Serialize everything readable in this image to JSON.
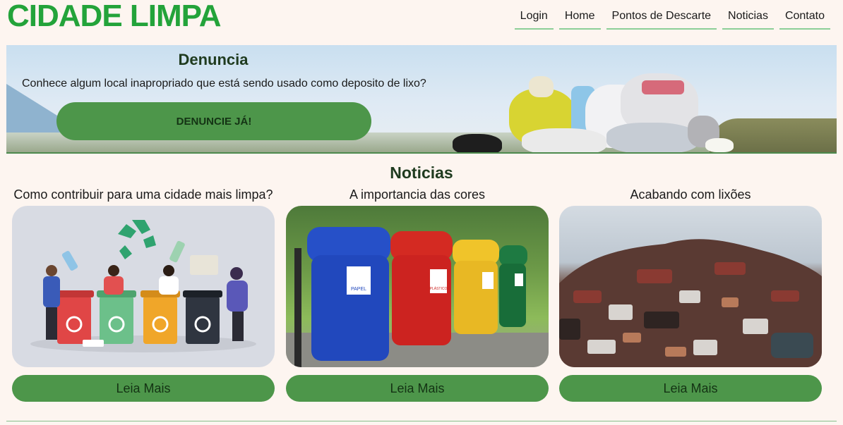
{
  "header": {
    "logo": "CIDADE LIMPA",
    "nav": [
      "Login",
      "Home",
      "Pontos de Descarte",
      "Noticias",
      "Contato"
    ]
  },
  "banner": {
    "title": "Denuncia",
    "text": "Conhece algum local inapropriado que está sendo usado como deposito de lixo?",
    "button": "DENUNCIE JÁ!"
  },
  "news": {
    "title": "Noticias",
    "cards": [
      {
        "title": "Como contribuir para uma cidade mais limpa?",
        "button": "Leia Mais",
        "image": "recycling-people-illustration"
      },
      {
        "title": "A importancia das cores",
        "button": "Leia Mais",
        "image": "colored-recycling-bins-photo"
      },
      {
        "title": "Acabando com lixões",
        "button": "Leia Mais",
        "image": "scrap-dump-photo"
      }
    ]
  },
  "bins": [
    {
      "label": "PAPEL"
    },
    {
      "label": "PLÁSTICO"
    }
  ],
  "colors": {
    "brand": "#23a33a",
    "button": "#4d964a",
    "background": "#fdf5f0"
  }
}
